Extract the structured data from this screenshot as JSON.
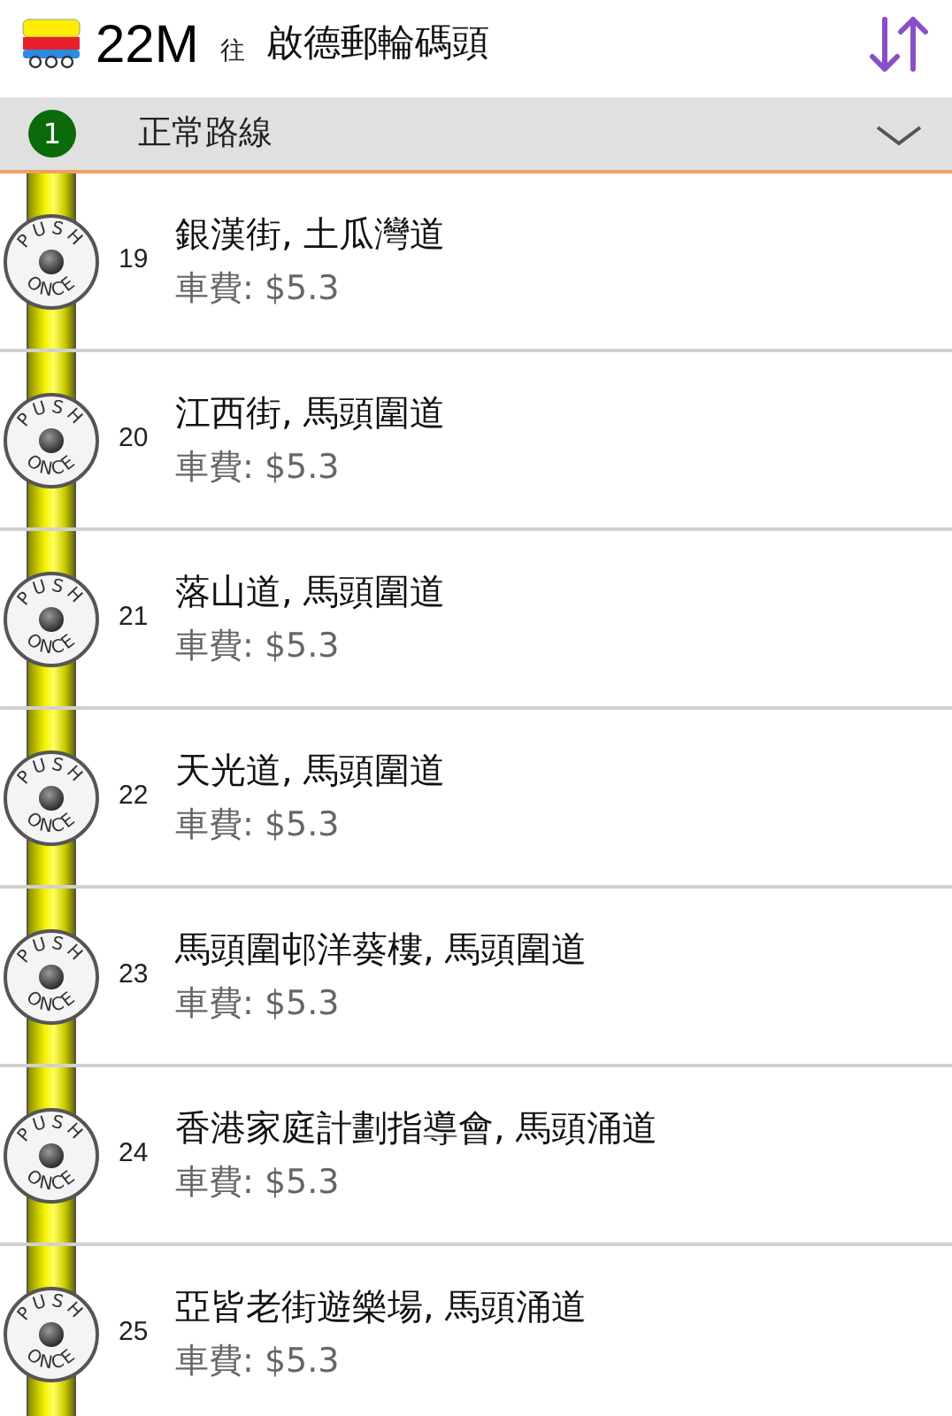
{
  "header": {
    "route": "22M",
    "towards": "往",
    "destination": "啟德郵輪碼頭"
  },
  "route_bar": {
    "badge": "1",
    "label": "正常路線",
    "expanded": false
  },
  "stops": [
    {
      "number": "19",
      "name": "銀漢街, 土瓜灣道",
      "fare": "車費: $5.3",
      "button_top": "PUSH",
      "button_bottom": "ONCE"
    },
    {
      "number": "20",
      "name": "江西街, 馬頭圍道",
      "fare": "車費: $5.3",
      "button_top": "PUSH",
      "button_bottom": "ONCE"
    },
    {
      "number": "21",
      "name": "落山道, 馬頭圍道",
      "fare": "車費: $5.3",
      "button_top": "PUSH",
      "button_bottom": "ONCE"
    },
    {
      "number": "22",
      "name": "天光道, 馬頭圍道",
      "fare": "車費: $5.3",
      "button_top": "PUSH",
      "button_bottom": "ONCE"
    },
    {
      "number": "23",
      "name": "馬頭圍邨洋葵樓, 馬頭圍道",
      "fare": "車費: $5.3",
      "button_top": "PUSH",
      "button_bottom": "ONCE"
    },
    {
      "number": "24",
      "name": "香港家庭計劃指導會, 馬頭涌道",
      "fare": "車費: $5.3",
      "button_top": "PUSH",
      "button_bottom": "ONCE"
    },
    {
      "number": "25",
      "name": "亞皆老街遊樂場, 馬頭涌道",
      "fare": "車費: $5.3",
      "button_top": "PUSH",
      "button_bottom": "ONCE"
    }
  ]
}
